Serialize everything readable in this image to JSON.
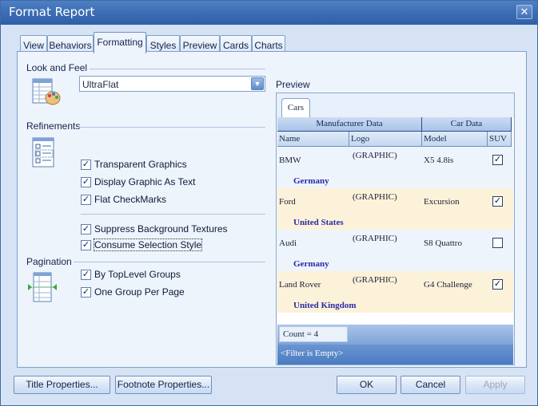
{
  "window": {
    "title": "Format Report",
    "close_glyph": "✕"
  },
  "tabs": [
    {
      "label": "View"
    },
    {
      "label": "Behaviors"
    },
    {
      "label": "Formatting"
    },
    {
      "label": "Styles"
    },
    {
      "label": "Preview"
    },
    {
      "label": "Cards"
    },
    {
      "label": "Charts"
    }
  ],
  "active_tab": "Formatting",
  "look_and_feel": {
    "label": "Look and Feel",
    "value": "UltraFlat"
  },
  "refinements": {
    "label": "Refinements",
    "items": [
      {
        "label": "Transparent Graphics",
        "checked": true
      },
      {
        "label": "Display Graphic As Text",
        "checked": true
      },
      {
        "label": "Flat CheckMarks",
        "checked": true
      },
      {
        "label": "Suppress Background Textures",
        "checked": true
      },
      {
        "label": "Consume Selection Style",
        "checked": true
      }
    ]
  },
  "pagination": {
    "label": "Pagination",
    "items": [
      {
        "label": "By TopLevel Groups",
        "checked": true
      },
      {
        "label": "One Group Per Page",
        "checked": true
      }
    ]
  },
  "preview": {
    "label": "Preview",
    "tab": "Cars",
    "bands": [
      "Manufacturer Data",
      "Car Data"
    ],
    "columns": [
      "Name",
      "Logo",
      "Model",
      "SUV"
    ],
    "rows": [
      {
        "name": "BMW",
        "logo": "(GRAPHIC)",
        "model": "X5 4.8is",
        "suv": true,
        "country": "Germany"
      },
      {
        "name": "Ford",
        "logo": "(GRAPHIC)",
        "model": "Excursion",
        "suv": true,
        "country": "United States"
      },
      {
        "name": "Audi",
        "logo": "(GRAPHIC)",
        "model": "S8 Quattro",
        "suv": false,
        "country": "Germany"
      },
      {
        "name": "Land Rover",
        "logo": "(GRAPHIC)",
        "model": "G4 Challenge",
        "suv": true,
        "country": "United Kingdom"
      }
    ],
    "count": "Count = 4",
    "filter": "<Filter is Empty>"
  },
  "buttons": {
    "title_props": "Title Properties...",
    "footnote_props": "Footnote Properties...",
    "ok": "OK",
    "cancel": "Cancel",
    "apply": "Apply"
  },
  "check_glyph": "✓"
}
